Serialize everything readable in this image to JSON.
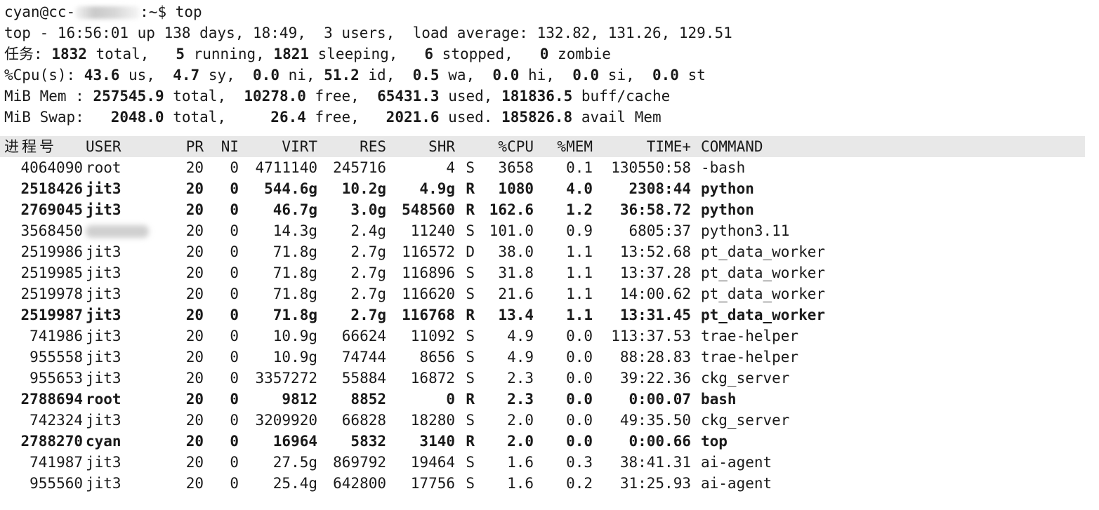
{
  "prompt": {
    "user_host": "cyan@cc-",
    "suffix": ":~$ top"
  },
  "summary": {
    "line1": "top - 16:56:01 up 138 days, 18:49,  3 users,  load average: 132.82, 131.26, 129.51",
    "tasks_label": "任务:",
    "tasks_total": "1832",
    "tasks_total_label": " total,   ",
    "tasks_running": "5",
    "tasks_running_label": " running, ",
    "tasks_sleeping": "1821",
    "tasks_sleeping_label": " sleeping,   ",
    "tasks_stopped": "6",
    "tasks_stopped_label": " stopped,   ",
    "tasks_zombie": "0",
    "tasks_zombie_label": " zombie",
    "cpu_label": "%Cpu(s): ",
    "cpu_us": "43.6",
    "cpu_us_label": " us,  ",
    "cpu_sy": "4.7",
    "cpu_sy_label": " sy,  ",
    "cpu_ni": "0.0",
    "cpu_ni_label": " ni, ",
    "cpu_id": "51.2",
    "cpu_id_label": " id,  ",
    "cpu_wa": "0.5",
    "cpu_wa_label": " wa,  ",
    "cpu_hi": "0.0",
    "cpu_hi_label": " hi,  ",
    "cpu_si": "0.0",
    "cpu_si_label": " si,  ",
    "cpu_st": "0.0",
    "cpu_st_label": " st",
    "mem_label": "MiB Mem : ",
    "mem_total": "257545.9",
    "mem_total_label": " total,  ",
    "mem_free": "10278.0",
    "mem_free_label": " free,  ",
    "mem_used": "65431.3",
    "mem_used_label": " used, ",
    "mem_buff": "181836.5",
    "mem_buff_label": " buff/cache",
    "swap_label": "MiB Swap:   ",
    "swap_total": "2048.0",
    "swap_total_label": " total,     ",
    "swap_free": "26.4",
    "swap_free_label": " free,   ",
    "swap_used": "2021.6",
    "swap_used_label": " used. ",
    "swap_avail": "185826.8",
    "swap_avail_label": " avail Mem"
  },
  "columns": {
    "pid": "进程号",
    "user": "USER",
    "pr": "PR",
    "ni": "NI",
    "virt": "VIRT",
    "res": "RES",
    "shr": "SHR",
    "s": "",
    "cpu": "%CPU",
    "mem": "%MEM",
    "time": "TIME+",
    "cmd": "COMMAND"
  },
  "processes": [
    {
      "pid": "4064090",
      "user": "root",
      "pr": "20",
      "ni": "0",
      "virt": "4711140",
      "res": "245716",
      "shr": "4",
      "s": "S",
      "cpu": "3658",
      "mem": "0.1",
      "time": "130550:58",
      "cmd": "-bash"
    },
    {
      "pid": "2518426",
      "user": "jit3",
      "pr": "20",
      "ni": "0",
      "virt": "544.6g",
      "res": "10.2g",
      "shr": "4.9g",
      "s": "R",
      "cpu": "1080",
      "mem": "4.0",
      "time": "2308:44",
      "cmd": "python"
    },
    {
      "pid": "2769045",
      "user": "jit3",
      "pr": "20",
      "ni": "0",
      "virt": "46.7g",
      "res": "3.0g",
      "shr": "548560",
      "s": "R",
      "cpu": "162.6",
      "mem": "1.2",
      "time": "36:58.72",
      "cmd": "python"
    },
    {
      "pid": "3568450",
      "user": "",
      "pr": "20",
      "ni": "0",
      "virt": "14.3g",
      "res": "2.4g",
      "shr": "11240",
      "s": "S",
      "cpu": "101.0",
      "mem": "0.9",
      "time": "6805:37",
      "cmd": "python3.11"
    },
    {
      "pid": "2519986",
      "user": "jit3",
      "pr": "20",
      "ni": "0",
      "virt": "71.8g",
      "res": "2.7g",
      "shr": "116572",
      "s": "D",
      "cpu": "38.0",
      "mem": "1.1",
      "time": "13:52.68",
      "cmd": "pt_data_worker"
    },
    {
      "pid": "2519985",
      "user": "jit3",
      "pr": "20",
      "ni": "0",
      "virt": "71.8g",
      "res": "2.7g",
      "shr": "116896",
      "s": "S",
      "cpu": "31.8",
      "mem": "1.1",
      "time": "13:37.28",
      "cmd": "pt_data_worker"
    },
    {
      "pid": "2519978",
      "user": "jit3",
      "pr": "20",
      "ni": "0",
      "virt": "71.8g",
      "res": "2.7g",
      "shr": "116620",
      "s": "S",
      "cpu": "21.6",
      "mem": "1.1",
      "time": "14:00.62",
      "cmd": "pt_data_worker"
    },
    {
      "pid": "2519987",
      "user": "jit3",
      "pr": "20",
      "ni": "0",
      "virt": "71.8g",
      "res": "2.7g",
      "shr": "116768",
      "s": "R",
      "cpu": "13.4",
      "mem": "1.1",
      "time": "13:31.45",
      "cmd": "pt_data_worker"
    },
    {
      "pid": "741986",
      "user": "jit3",
      "pr": "20",
      "ni": "0",
      "virt": "10.9g",
      "res": "66624",
      "shr": "11092",
      "s": "S",
      "cpu": "4.9",
      "mem": "0.0",
      "time": "113:37.53",
      "cmd": "trae-helper"
    },
    {
      "pid": "955558",
      "user": "jit3",
      "pr": "20",
      "ni": "0",
      "virt": "10.9g",
      "res": "74744",
      "shr": "8656",
      "s": "S",
      "cpu": "4.9",
      "mem": "0.0",
      "time": "88:28.83",
      "cmd": "trae-helper"
    },
    {
      "pid": "955653",
      "user": "jit3",
      "pr": "20",
      "ni": "0",
      "virt": "3357272",
      "res": "55884",
      "shr": "16872",
      "s": "S",
      "cpu": "2.3",
      "mem": "0.0",
      "time": "39:22.36",
      "cmd": "ckg_server"
    },
    {
      "pid": "2788694",
      "user": "root",
      "pr": "20",
      "ni": "0",
      "virt": "9812",
      "res": "8852",
      "shr": "0",
      "s": "R",
      "cpu": "2.3",
      "mem": "0.0",
      "time": "0:00.07",
      "cmd": "bash"
    },
    {
      "pid": "742324",
      "user": "jit3",
      "pr": "20",
      "ni": "0",
      "virt": "3209920",
      "res": "66828",
      "shr": "18280",
      "s": "S",
      "cpu": "2.0",
      "mem": "0.0",
      "time": "49:35.50",
      "cmd": "ckg_server"
    },
    {
      "pid": "2788270",
      "user": "cyan",
      "pr": "20",
      "ni": "0",
      "virt": "16964",
      "res": "5832",
      "shr": "3140",
      "s": "R",
      "cpu": "2.0",
      "mem": "0.0",
      "time": "0:00.66",
      "cmd": "top"
    },
    {
      "pid": "741987",
      "user": "jit3",
      "pr": "20",
      "ni": "0",
      "virt": "27.5g",
      "res": "869792",
      "shr": "19464",
      "s": "S",
      "cpu": "1.6",
      "mem": "0.3",
      "time": "38:41.31",
      "cmd": "ai-agent"
    },
    {
      "pid": "955560",
      "user": "jit3",
      "pr": "20",
      "ni": "0",
      "virt": "25.4g",
      "res": "642800",
      "shr": "17756",
      "s": "S",
      "cpu": "1.6",
      "mem": "0.2",
      "time": "31:25.93",
      "cmd": "ai-agent"
    }
  ],
  "running_state": "R"
}
